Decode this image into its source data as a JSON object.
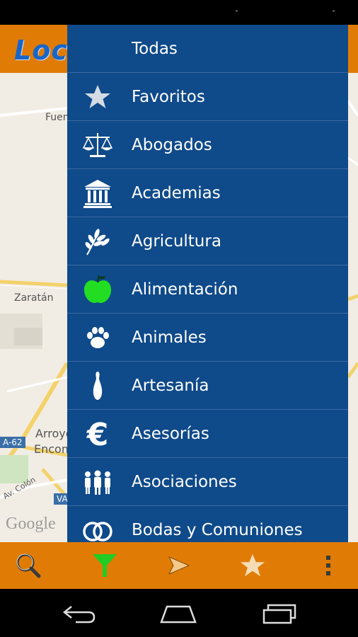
{
  "app": {
    "logo_text": "Loc"
  },
  "map": {
    "labels": [
      "Fuen",
      "Zaratán",
      "Arroyo",
      "Encom",
      "Av. Colón",
      "Google"
    ],
    "road_badges": [
      "A-62",
      "VA"
    ]
  },
  "drawer": {
    "items": [
      {
        "label": "Todas",
        "icon": "none"
      },
      {
        "label": "Favoritos",
        "icon": "star-icon"
      },
      {
        "label": "Abogados",
        "icon": "scales-icon"
      },
      {
        "label": "Academias",
        "icon": "building-icon"
      },
      {
        "label": "Agricultura",
        "icon": "wheat-icon"
      },
      {
        "label": "Alimentación",
        "icon": "apple-icon"
      },
      {
        "label": "Animales",
        "icon": "paw-icon"
      },
      {
        "label": "Artesanía",
        "icon": "bowling-pin-icon"
      },
      {
        "label": "Asesorías",
        "icon": "euro-icon"
      },
      {
        "label": "Asociaciones",
        "icon": "people-icon"
      },
      {
        "label": "Bodas y Comuniones",
        "icon": "rings-icon"
      }
    ]
  },
  "bottom_bar": {
    "buttons": [
      "search-icon",
      "filter-icon",
      "send-icon",
      "star-icon",
      "more-icon"
    ]
  },
  "nav_bar": {
    "buttons": [
      "back-icon",
      "home-icon",
      "recents-icon"
    ]
  },
  "colors": {
    "header": "#e07c06",
    "drawer": "#0f4a8a",
    "filter_active": "#22cc22",
    "apple": "#22dd22"
  }
}
